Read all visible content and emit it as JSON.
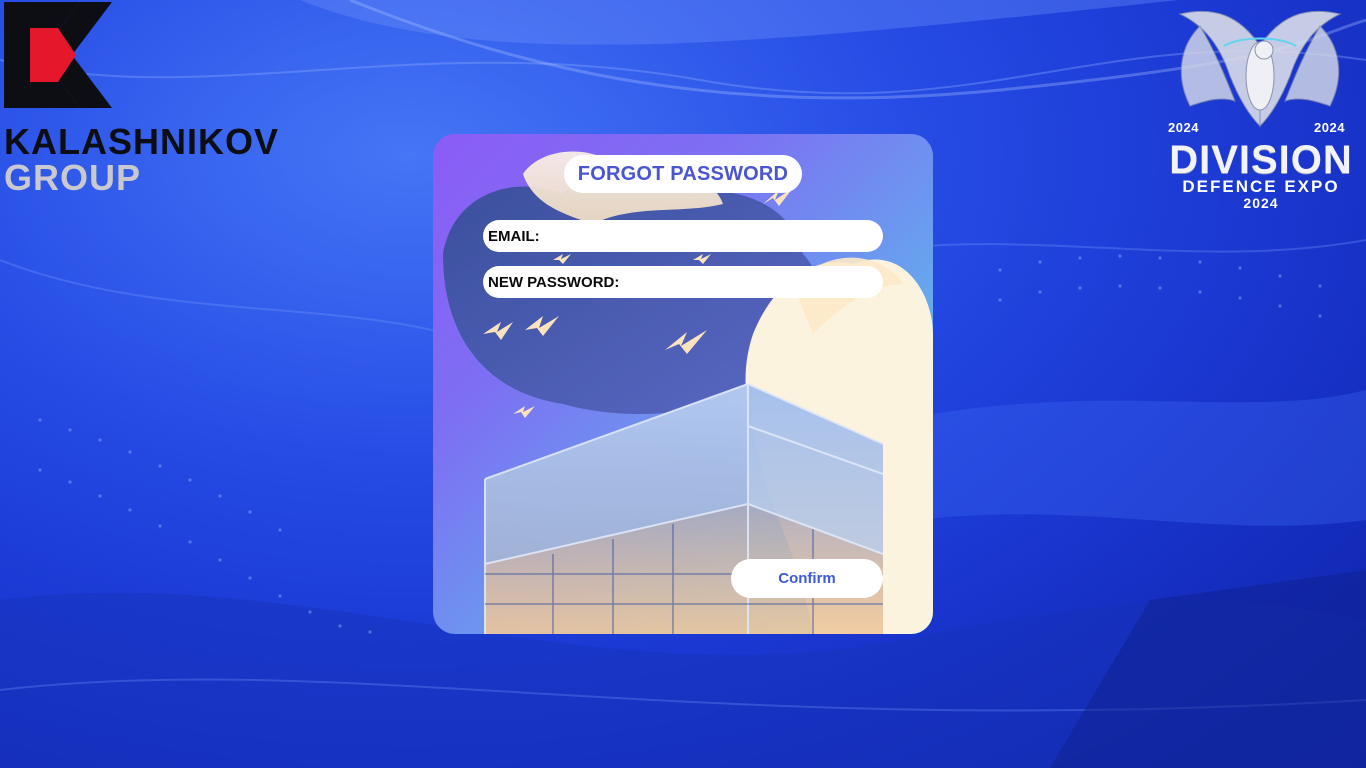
{
  "brand_left": {
    "name_line1": "KALASHNIKOV",
    "name_line2": "GROUP",
    "mark_icon": "kalashnikov-k-logo",
    "colors": {
      "black": "#0d0d14",
      "red": "#e5172b",
      "grey": "#c9c9cf"
    }
  },
  "brand_right": {
    "emblem_icon": "phoenix-emblem",
    "year_left": "2024",
    "year_right": "2024",
    "title": "DIVISION",
    "subtitle": "DEFENCE EXPO",
    "year_bottom": "2024"
  },
  "form": {
    "title": "FORGOT PASSWORD",
    "email_label": "EMAIL:",
    "email_value": "",
    "new_password_label": "NEW PASSWORD:",
    "new_password_value": "",
    "confirm_label": "Confirm"
  },
  "colors": {
    "background": "#1f46e6",
    "card_gradient_start": "#8b5cf6",
    "card_gradient_end": "#5fe0e2",
    "title_text": "#4a55d6",
    "button_text": "#3c5bd8"
  }
}
